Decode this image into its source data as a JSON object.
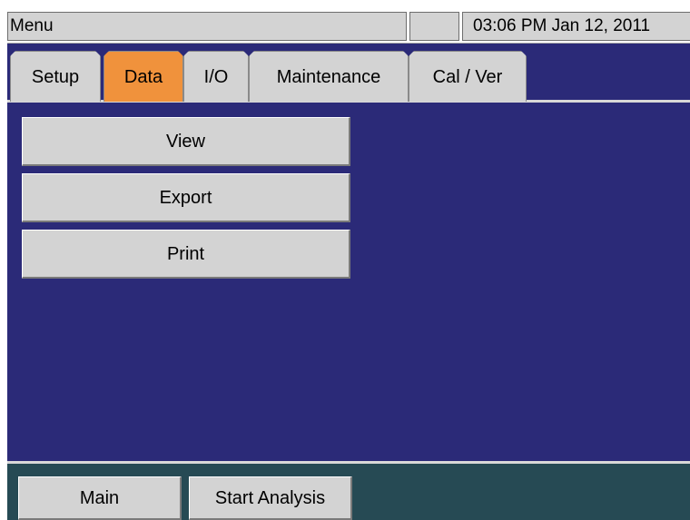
{
  "titlebar": {
    "menu_label": "Menu",
    "status_blank": "",
    "datetime": "03:06 PM Jan 12, 2011"
  },
  "tabs": [
    {
      "label": "Setup",
      "active": false
    },
    {
      "label": "Data",
      "active": true
    },
    {
      "label": "I/O",
      "active": false
    },
    {
      "label": "Maintenance",
      "active": false
    },
    {
      "label": "Cal / Ver",
      "active": false
    }
  ],
  "content": {
    "buttons": [
      {
        "label": "View"
      },
      {
        "label": "Export"
      },
      {
        "label": "Print"
      }
    ]
  },
  "bottombar": {
    "main_label": "Main",
    "start_analysis_label": "Start Analysis"
  },
  "colors": {
    "background": "#2b2a78",
    "active_tab": "#f0923c",
    "button_gray": "#d3d3d3",
    "bottom_bar": "#264a54"
  }
}
